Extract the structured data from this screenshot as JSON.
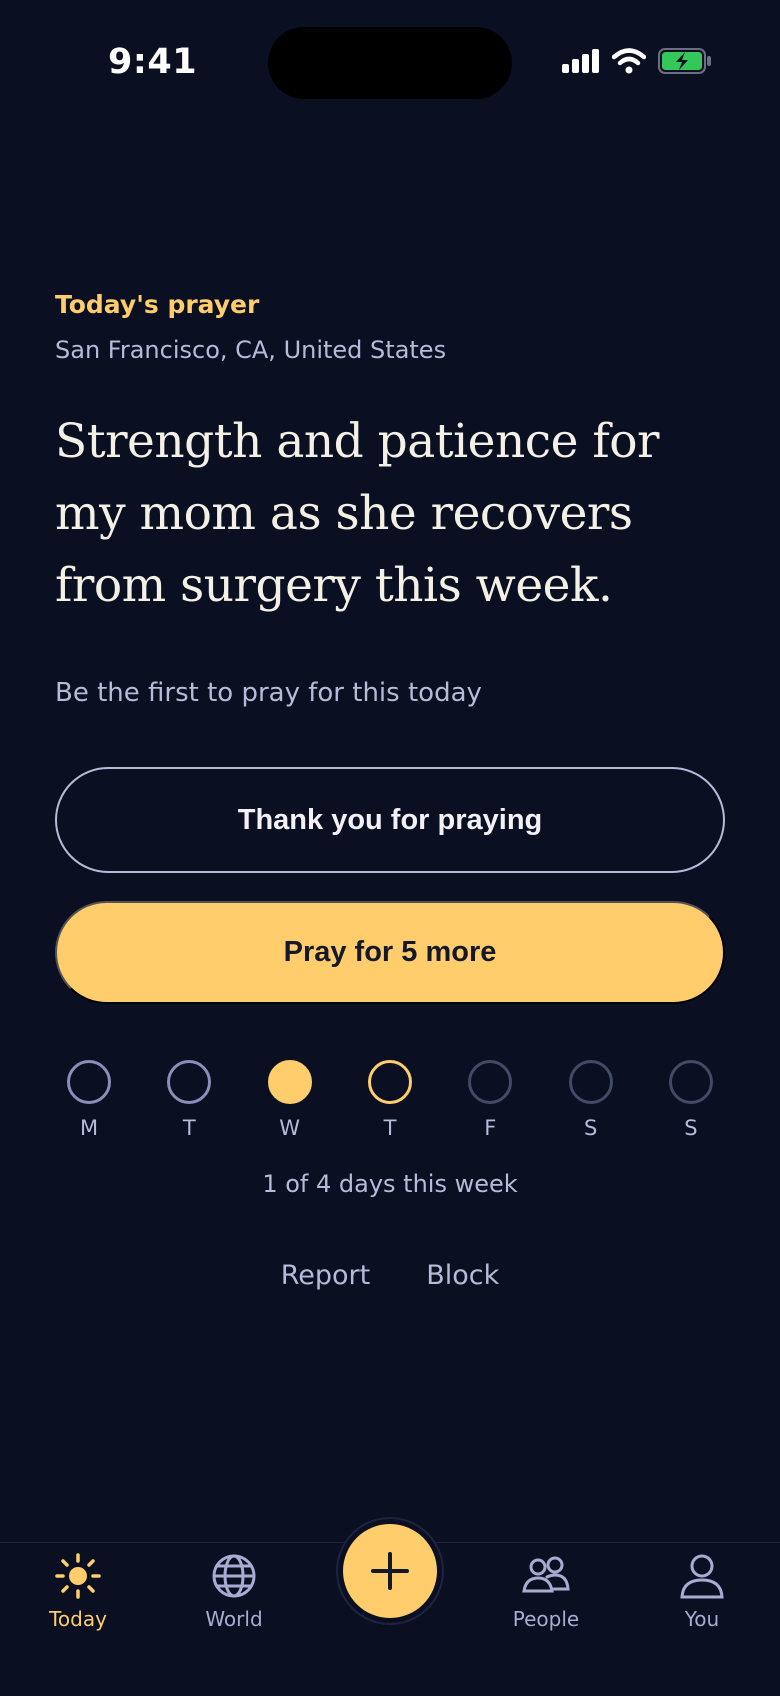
{
  "status_bar": {
    "time": "9:41"
  },
  "prayer": {
    "eyebrow": "Today's prayer",
    "location": "San Francisco, CA, United States",
    "text": "Strength and patience for my mom as she recovers from surgery this week.",
    "first_pray": "Be the first to pray for this today"
  },
  "buttons": {
    "thank_you": "Thank you for praying",
    "pray_more": "Pray for 5 more"
  },
  "week": {
    "days": [
      {
        "label": "M",
        "state": "missed"
      },
      {
        "label": "T",
        "state": "missed"
      },
      {
        "label": "W",
        "state": "done"
      },
      {
        "label": "T",
        "state": "today"
      },
      {
        "label": "F",
        "state": "future"
      },
      {
        "label": "S",
        "state": "future"
      },
      {
        "label": "S",
        "state": "future"
      }
    ],
    "summary": "1 of 4 days this week"
  },
  "actions": {
    "report": "Report",
    "block": "Block"
  },
  "tabs": [
    {
      "label": "Today",
      "icon": "sun-icon",
      "active": true
    },
    {
      "label": "World",
      "icon": "globe-icon",
      "active": false
    },
    {
      "label": "People",
      "icon": "people-icon",
      "active": false
    },
    {
      "label": "You",
      "icon": "user-icon",
      "active": false
    }
  ],
  "colors": {
    "background": "#0b0f22",
    "accent": "#ffcd6b",
    "text_muted": "#b8bad8"
  }
}
